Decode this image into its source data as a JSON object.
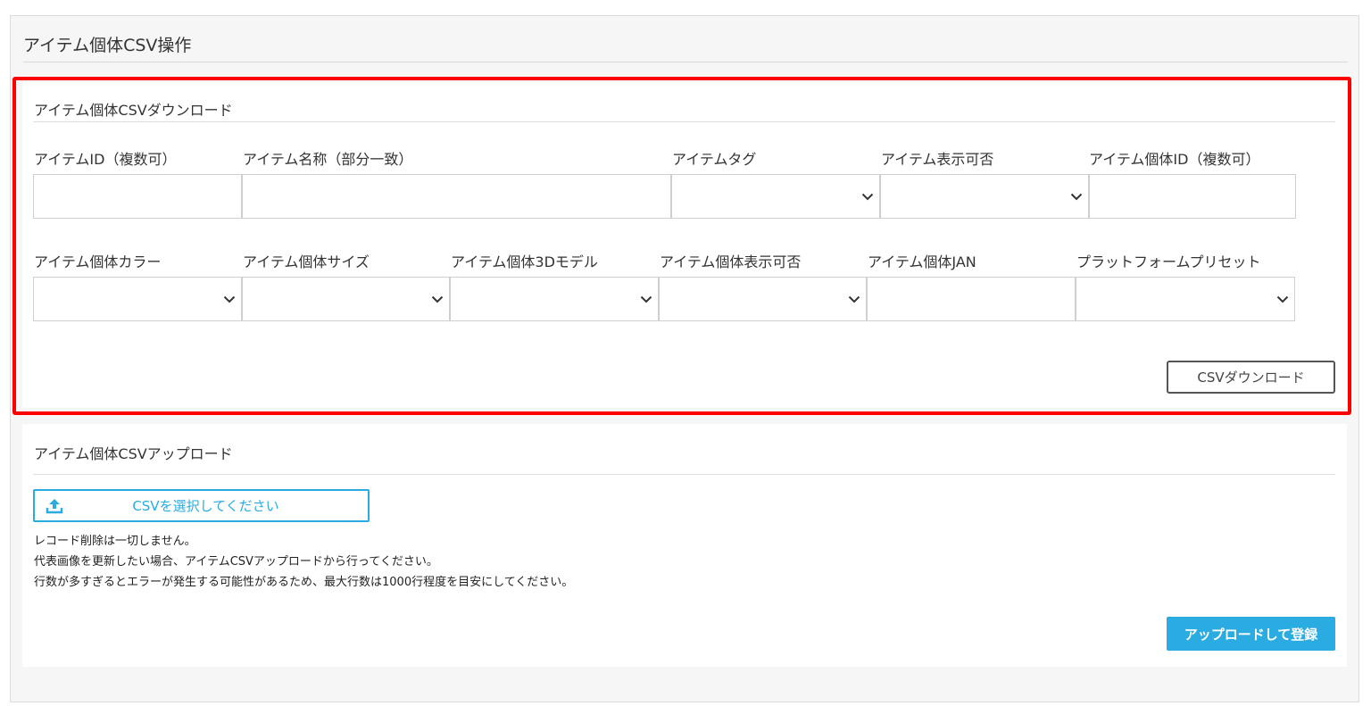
{
  "page": {
    "title": "アイテム個体CSV操作"
  },
  "download": {
    "title": "アイテム個体CSVダウンロード",
    "fields": {
      "item_id": {
        "label": "アイテムID（複数可）",
        "value": ""
      },
      "item_name": {
        "label": "アイテム名称（部分一致）",
        "value": ""
      },
      "item_tag": {
        "label": "アイテムタグ",
        "value": ""
      },
      "item_visibility": {
        "label": "アイテム表示可否",
        "value": ""
      },
      "instance_id": {
        "label": "アイテム個体ID（複数可）",
        "value": ""
      },
      "instance_color": {
        "label": "アイテム個体カラー",
        "value": ""
      },
      "instance_size": {
        "label": "アイテム個体サイズ",
        "value": ""
      },
      "instance_3d_model": {
        "label": "アイテム個体3Dモデル",
        "value": ""
      },
      "instance_visibility": {
        "label": "アイテム個体表示可否",
        "value": ""
      },
      "instance_jan": {
        "label": "アイテム個体JAN",
        "value": ""
      },
      "platform_preset": {
        "label": "プラットフォームプリセット",
        "value": ""
      }
    },
    "button_label": "CSVダウンロード"
  },
  "upload": {
    "title": "アイテム個体CSVアップロード",
    "file_button_label": "CSVを選択してください",
    "notes": [
      "レコード削除は一切しません。",
      "代表画像を更新したい場合、アイテムCSVアップロードから行ってください。",
      "行数が多すぎるとエラーが発生する可能性があるため、最大行数は1000行程度を目安にしてください。"
    ],
    "submit_label": "アップロードして登録"
  },
  "colors": {
    "accent": "#2aabe1",
    "highlight": "#ff0000",
    "panel_bg": "#f6f6f6"
  },
  "icons": {
    "chevron": "chevron-down-icon",
    "upload": "upload-icon"
  }
}
